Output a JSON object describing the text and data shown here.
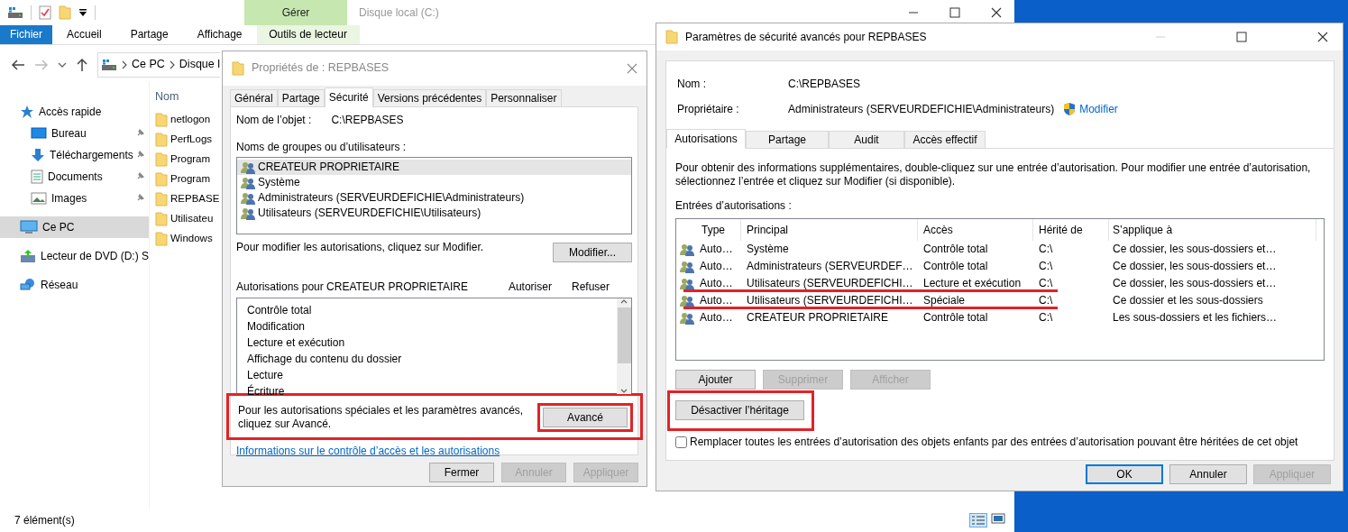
{
  "explorer": {
    "title": "Disque local (C:)",
    "context_tab": "Gérer",
    "ribbon_tabs": [
      {
        "label": "Fichier",
        "kind": "file"
      },
      {
        "label": "Accueil",
        "kind": "normal"
      },
      {
        "label": "Partage",
        "kind": "normal"
      },
      {
        "label": "Affichage",
        "kind": "normal"
      },
      {
        "label": "Outils de lecteur",
        "kind": "context"
      }
    ],
    "address": [
      "Ce PC",
      "Disque l"
    ],
    "nav": [
      {
        "label": "Accès rapide",
        "kind": "star",
        "selected": false,
        "pinned": false,
        "children": [
          {
            "label": "Bureau",
            "kind": "desktop",
            "selected": false,
            "pinned": true
          },
          {
            "label": "Téléchargements",
            "kind": "download",
            "selected": false,
            "pinned": true
          },
          {
            "label": "Documents",
            "kind": "document",
            "selected": false,
            "pinned": true
          },
          {
            "label": "Images",
            "kind": "images",
            "selected": false,
            "pinned": true
          }
        ]
      },
      {
        "label": "Ce PC",
        "kind": "pc",
        "selected": true,
        "pinned": false
      },
      {
        "label": "Lecteur de DVD (D:) S",
        "kind": "dvd",
        "selected": false,
        "pinned": false
      },
      {
        "label": "Réseau",
        "kind": "network",
        "selected": false,
        "pinned": false
      }
    ],
    "column": "Nom",
    "files": [
      "netlogon",
      "PerfLogs",
      "Program",
      "Program",
      "REPBASE",
      "Utilisateu",
      "Windows"
    ],
    "status": "7 élément(s)"
  },
  "properties": {
    "title": "Propriétés de : REPBASES",
    "tabs": [
      {
        "label": "Général",
        "selected": false
      },
      {
        "label": "Partage",
        "selected": false
      },
      {
        "label": "Sécurité",
        "selected": true
      },
      {
        "label": "Versions précédentes",
        "selected": false
      },
      {
        "label": "Personnaliser",
        "selected": false
      }
    ],
    "object_label": "Nom de l’objet :",
    "object_value": "C:\\REPBASES",
    "groups_label": "Noms de groupes ou d’utilisateurs :",
    "groups": [
      {
        "name": "CREATEUR PROPRIETAIRE",
        "selected": true
      },
      {
        "name": "Système",
        "selected": false
      },
      {
        "name": "Administrateurs (SERVEURDEFICHIE\\Administrateurs)",
        "selected": false
      },
      {
        "name": "Utilisateurs (SERVEURDEFICHIE\\Utilisateurs)",
        "selected": false
      }
    ],
    "modify_hint": "Pour modifier les autorisations, cliquez sur Modifier.",
    "modify_button": "Modifier...",
    "perm_label": "Autorisations pour CREATEUR PROPRIETAIRE",
    "allow_header": "Autoriser",
    "deny_header": "Refuser",
    "permissions": [
      "Contrôle total",
      "Modification",
      "Lecture et exécution",
      "Affichage du contenu du dossier",
      "Lecture",
      "Écriture"
    ],
    "advanced_hint": "Pour les autorisations spéciales et les paramètres avancés, cliquez sur Avancé.",
    "advanced_button": "Avancé",
    "advanced_highlighted": true,
    "link": "Informations sur le contrôle d’accès et les autorisations",
    "buttons": [
      {
        "label": "Fermer",
        "disabled": false
      },
      {
        "label": "Annuler",
        "disabled": true
      },
      {
        "label": "Appliquer",
        "disabled": true
      }
    ]
  },
  "advanced": {
    "title": "Paramètres de sécurité avancés pour REPBASES",
    "name_label": "Nom :",
    "name_value": "C:\\REPBASES",
    "owner_label": "Propriétaire :",
    "owner_value": "Administrateurs (SERVEURDEFICHIE\\Administrateurs)",
    "owner_link": "Modifier",
    "tabs": [
      {
        "label": "Autorisations",
        "selected": true
      },
      {
        "label": "Partage",
        "selected": false
      },
      {
        "label": "Audit",
        "selected": false
      },
      {
        "label": "Accès effectif",
        "selected": false
      }
    ],
    "info": "Pour obtenir des informations supplémentaires, double-cliquez sur une entrée d’autorisation. Pour modifier une entrée d’autorisation, sélectionnez l’entrée et cliquez sur Modifier (si disponible).",
    "entries_label": "Entrées d’autorisations :",
    "columns": [
      "Type",
      "Principal",
      "Accès",
      "Hérité de",
      "S’applique à"
    ],
    "rows": [
      {
        "type": "Auto…",
        "principal": "Système",
        "access": "Contrôle total",
        "inherited": "C:\\",
        "applies": "Ce dossier, les sous-dossiers et…",
        "struck": false
      },
      {
        "type": "Auto…",
        "principal": "Administrateurs (SERVEURDEF…",
        "access": "Contrôle total",
        "inherited": "C:\\",
        "applies": "Ce dossier, les sous-dossiers et…",
        "struck": false
      },
      {
        "type": "Auto…",
        "principal": "Utilisateurs (SERVEURDEFICHI…",
        "access": "Lecture et exécution",
        "inherited": "C:\\",
        "applies": "Ce dossier, les sous-dossiers et…",
        "struck": true
      },
      {
        "type": "Auto…",
        "principal": "Utilisateurs (SERVEURDEFICHI…",
        "access": "Spéciale",
        "inherited": "C:\\",
        "applies": "Ce dossier et les sous-dossiers",
        "struck": true
      },
      {
        "type": "Auto…",
        "principal": "CREATEUR PROPRIETAIRE",
        "access": "Contrôle total",
        "inherited": "C:\\",
        "applies": "Les sous-dossiers et les fichiers…",
        "struck": false
      }
    ],
    "row_buttons": [
      {
        "label": "Ajouter",
        "disabled": false
      },
      {
        "label": "Supprimer",
        "disabled": true
      },
      {
        "label": "Afficher",
        "disabled": true
      }
    ],
    "inheritance_button": "Désactiver l’héritage",
    "inheritance_highlighted": true,
    "replace": {
      "label": "Remplacer toutes les entrées d’autorisation des objets enfants par des entrées d’autorisation pouvant être héritées de cet objet",
      "checked": false
    },
    "buttons": [
      {
        "label": "OK",
        "disabled": false,
        "default": true
      },
      {
        "label": "Annuler",
        "disabled": false,
        "default": false
      },
      {
        "label": "Appliquer",
        "disabled": true,
        "default": false
      }
    ]
  }
}
